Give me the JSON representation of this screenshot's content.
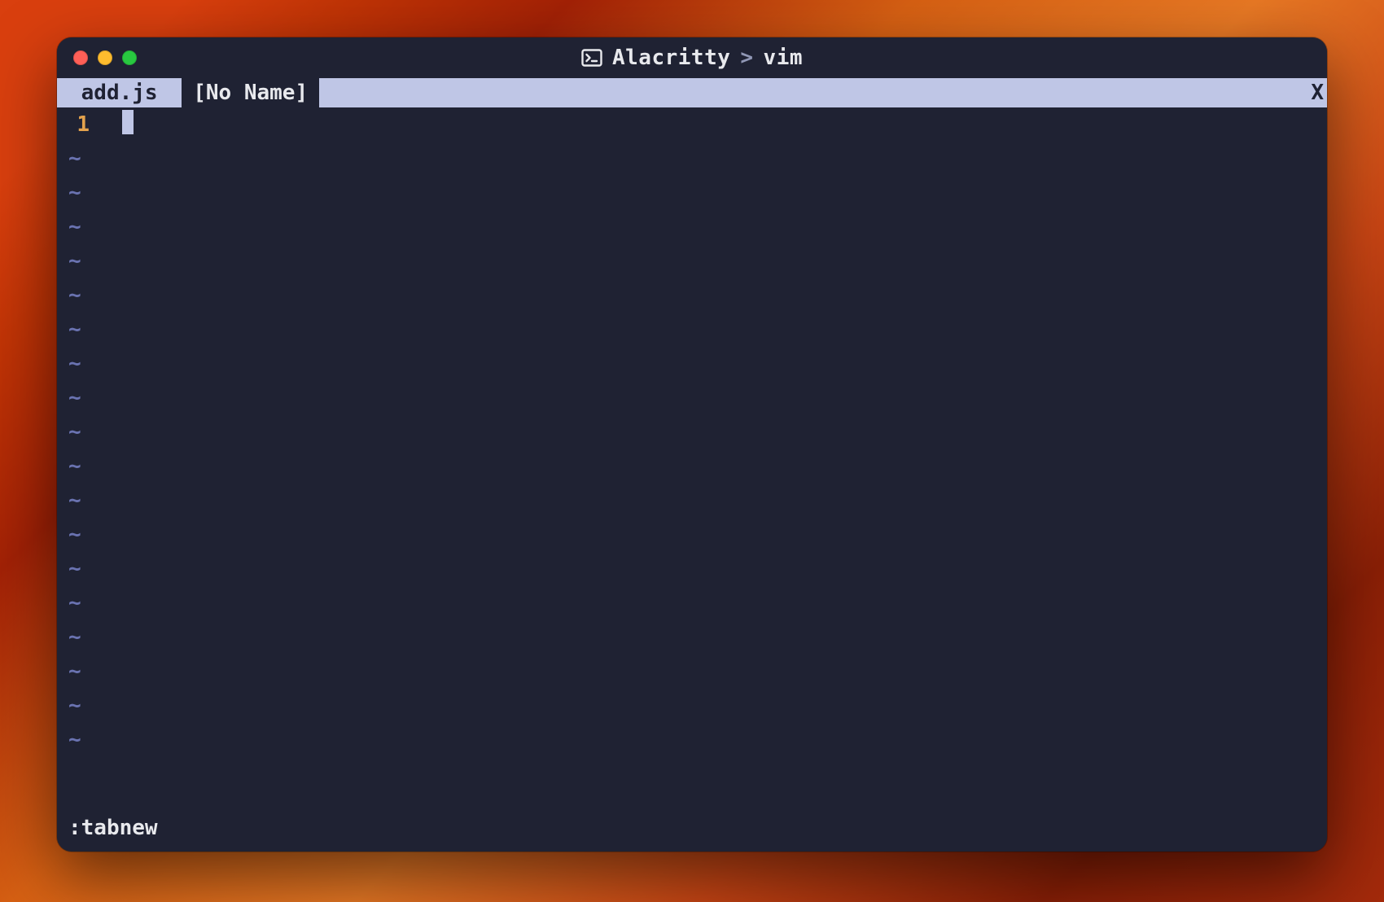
{
  "titlebar": {
    "app": "Alacritty",
    "separator": ">",
    "process": "vim"
  },
  "tabs": {
    "inactive_label": " add.js ",
    "active_label": "[No Name]",
    "close_char": "X"
  },
  "editor": {
    "current_line_number": "1",
    "tilde_rows": 18,
    "tilde_char": "~"
  },
  "command": {
    "text": ":tabnew"
  }
}
